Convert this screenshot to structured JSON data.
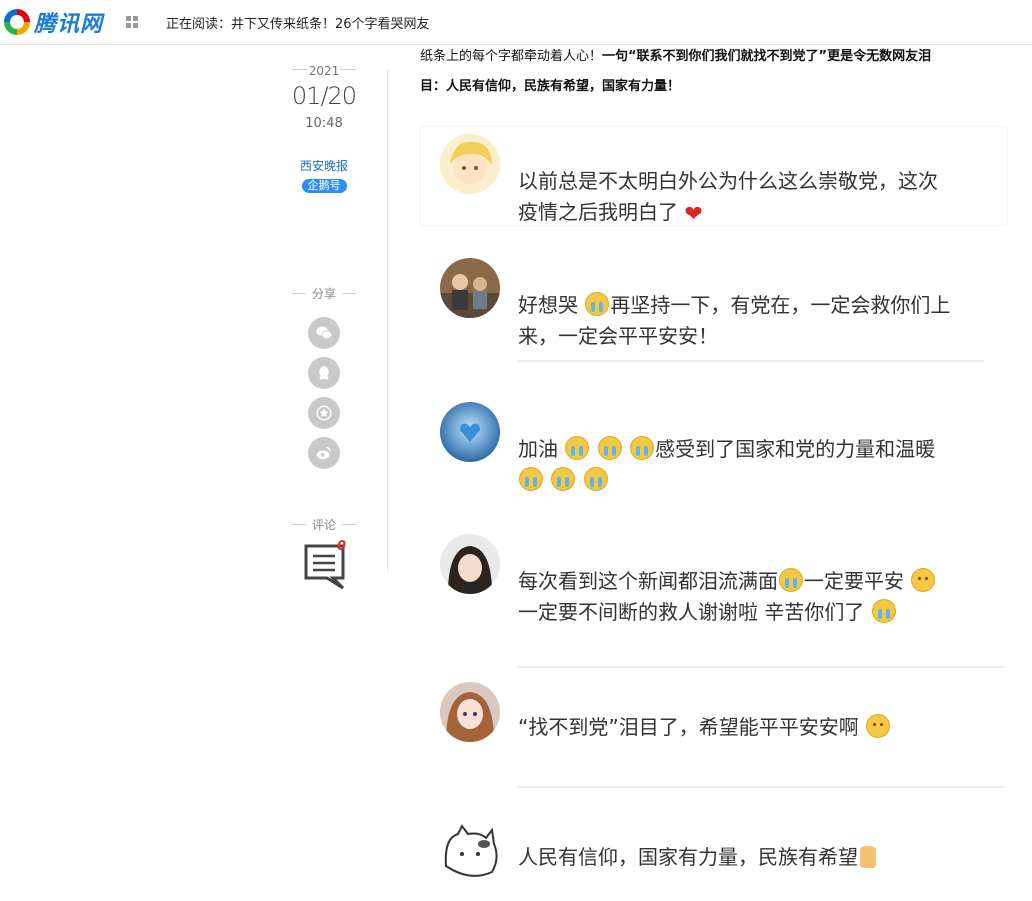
{
  "header": {
    "logo_text": "腾讯网",
    "reading_label": "正在阅读：",
    "reading_title": "井下又传来纸条！26个字看哭网友"
  },
  "meta": {
    "year": "2021",
    "date": "01/20",
    "time": "10:48",
    "source": "西安晚报",
    "badge": "企鹅号",
    "share_label": "分享",
    "comment_label": "评论",
    "comment_count": "0"
  },
  "share_buttons": [
    "wechat-icon",
    "qq-icon",
    "qzone-icon",
    "weibo-icon"
  ],
  "article": {
    "intro_plain": "纸条上的每个字都牵动着人心！",
    "intro_bold_1": "一句“联系不到你们我们就找不到党了”更是令无数网友泪",
    "intro_bold_2": "目：人民有信仰，民族有希望，国家有力量！"
  },
  "comments": [
    {
      "text_1": "以前总是不太明白外公为什么这么崇敬党，这次",
      "text_2": "疫情之后我明白了"
    },
    {
      "text_1a": "好想哭",
      "text_1b": "再坚持一下，有党在，一定会救你们上",
      "text_2": "来，一定会平平安安！"
    },
    {
      "text_1a": "加油",
      "text_1b": "感受到了国家和党的力量和温暖"
    },
    {
      "text_1a": "每次看到这个新闻都泪流满面",
      "text_1b": "一定要平安",
      "text_2": "一定要不间断的救人谢谢啦 辛苦你们了"
    },
    {
      "text_1": "“找不到党”泪目了，希望能平平安安啊"
    },
    {
      "text_1": "人民有信仰，国家有力量，民族有希望"
    }
  ]
}
